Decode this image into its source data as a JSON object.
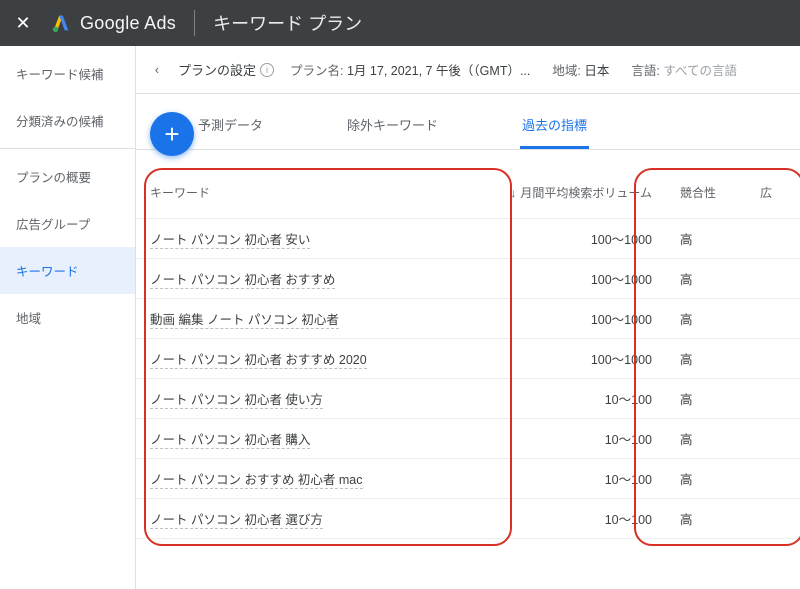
{
  "appbar": {
    "brand": "Google Ads",
    "section": "キーワード プラン"
  },
  "sidenav": {
    "items": [
      {
        "label": "キーワード候補"
      },
      {
        "label": "分類済みの候補"
      },
      {
        "label": "プランの概要"
      },
      {
        "label": "広告グループ"
      },
      {
        "label": "キーワード"
      },
      {
        "label": "地域"
      }
    ]
  },
  "planbar": {
    "settings_label": "プランの設定",
    "plan_name_label": "プラン名:",
    "plan_name_value": "1月 17, 2021, 7 午後（（GMT）...",
    "region_label": "地域:",
    "region_value": "日本",
    "lang_label": "言語:",
    "lang_value": "すべての言語"
  },
  "tabs": {
    "items": [
      "予測データ",
      "除外キーワード",
      "過去の指標"
    ],
    "active_index": 2
  },
  "table": {
    "headers": {
      "keyword": "キーワード",
      "volume": "月間平均検索ボリューム",
      "competition": "競合性",
      "ad": "広"
    },
    "rows": [
      {
        "kw": "ノート パソコン 初心者 安い",
        "vol": "100～1000",
        "comp": "高"
      },
      {
        "kw": "ノート パソコン 初心者 おすすめ",
        "vol": "100～1000",
        "comp": "高"
      },
      {
        "kw": "動画 編集 ノート パソコン 初心者",
        "vol": "100～1000",
        "comp": "高"
      },
      {
        "kw": "ノート パソコン 初心者 おすすめ 2020",
        "vol": "100～1000",
        "comp": "高"
      },
      {
        "kw": "ノート パソコン 初心者 使い方",
        "vol": "10～100",
        "comp": "高"
      },
      {
        "kw": "ノート パソコン 初心者 購入",
        "vol": "10～100",
        "comp": "高"
      },
      {
        "kw": "ノート パソコン おすすめ 初心者 mac",
        "vol": "10～100",
        "comp": "高"
      },
      {
        "kw": "ノート パソコン 初心者 選び方",
        "vol": "10～100",
        "comp": "高"
      }
    ]
  },
  "glyphs": {
    "close": "✕",
    "back": "‹",
    "plus": "+",
    "info": "i",
    "sort_desc": "↓"
  }
}
